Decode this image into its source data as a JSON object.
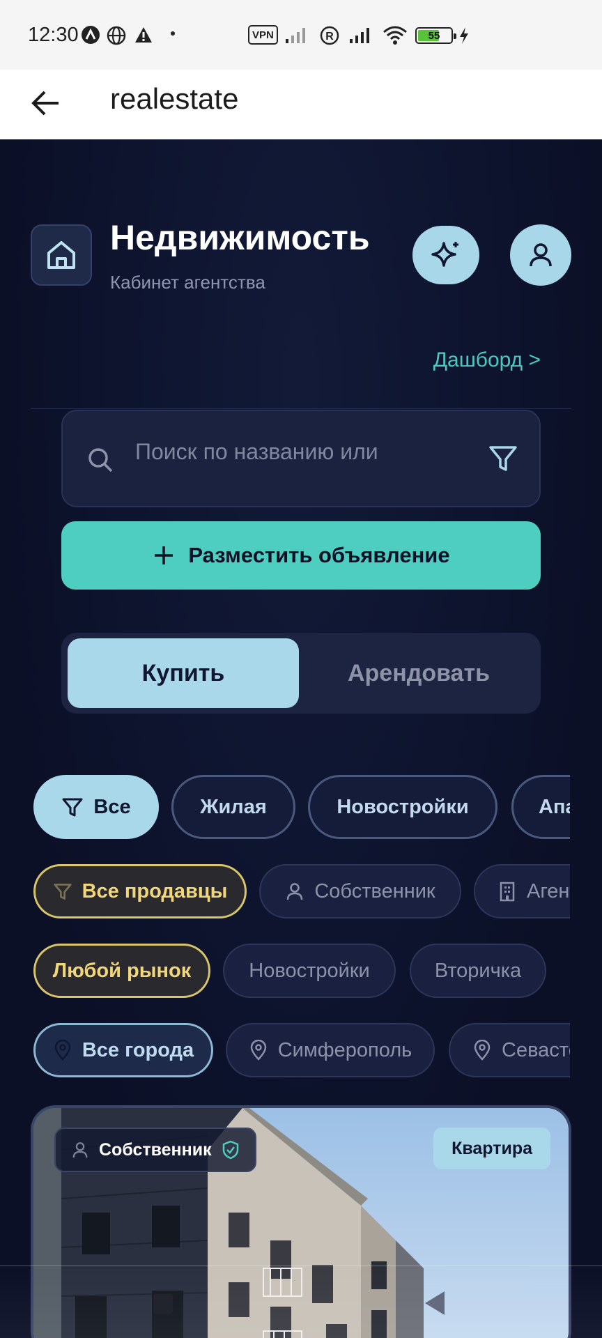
{
  "status_bar": {
    "time": "12:30",
    "vpn": "VPN",
    "battery_level": "55"
  },
  "app_bar": {
    "title": "realestate"
  },
  "header": {
    "title": "Недвижимость",
    "subtitle": "Кабинет агентства",
    "dashboard_link": "Дашборд >"
  },
  "search": {
    "placeholder": "Поиск по названию или"
  },
  "cta": {
    "label": "Разместить объявление"
  },
  "segment": {
    "buy": "Купить",
    "rent": "Арендовать"
  },
  "property_types": [
    "Все",
    "Жилая",
    "Новостройки",
    "Апартаменты"
  ],
  "sellers": [
    "Все продавцы",
    "Собственник",
    "Агентство"
  ],
  "markets": [
    "Любой рынок",
    "Новостройки",
    "Вторичка"
  ],
  "cities": [
    "Все города",
    "Симферополь",
    "Севастополь"
  ],
  "listing": {
    "owner_badge": "Собственник",
    "type_badge": "Квартира"
  },
  "colors": {
    "accent": "#4ecdc1",
    "active_chip": "#a8d8ea",
    "yellow_chip": "#d9c56a",
    "background": "#0c1128"
  }
}
